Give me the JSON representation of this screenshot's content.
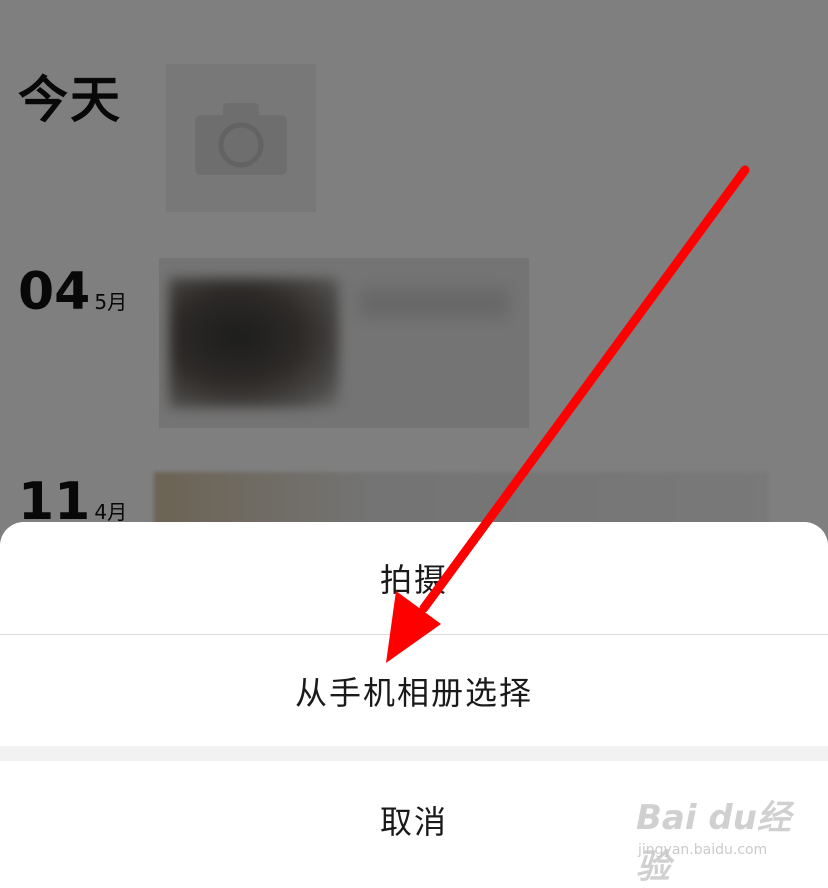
{
  "feed": {
    "today_label": "今天",
    "camera_icon": "camera-icon",
    "posts": [
      {
        "day": "04",
        "month": "5月"
      },
      {
        "day": "11",
        "month": "4月"
      }
    ]
  },
  "action_sheet": {
    "items": [
      {
        "label": "拍摄"
      },
      {
        "label": "从手机相册选择"
      }
    ],
    "cancel_label": "取消"
  },
  "watermark": {
    "logo": "Bai du经验",
    "url": "jingyan.baidu.com"
  },
  "annotation": {
    "arrow_color": "#ff0000"
  },
  "colors": {
    "overlay": "rgba(0,0,0,0.5)",
    "sheet_background": "#f2f2f2",
    "sheet_item_background": "#ffffff"
  }
}
